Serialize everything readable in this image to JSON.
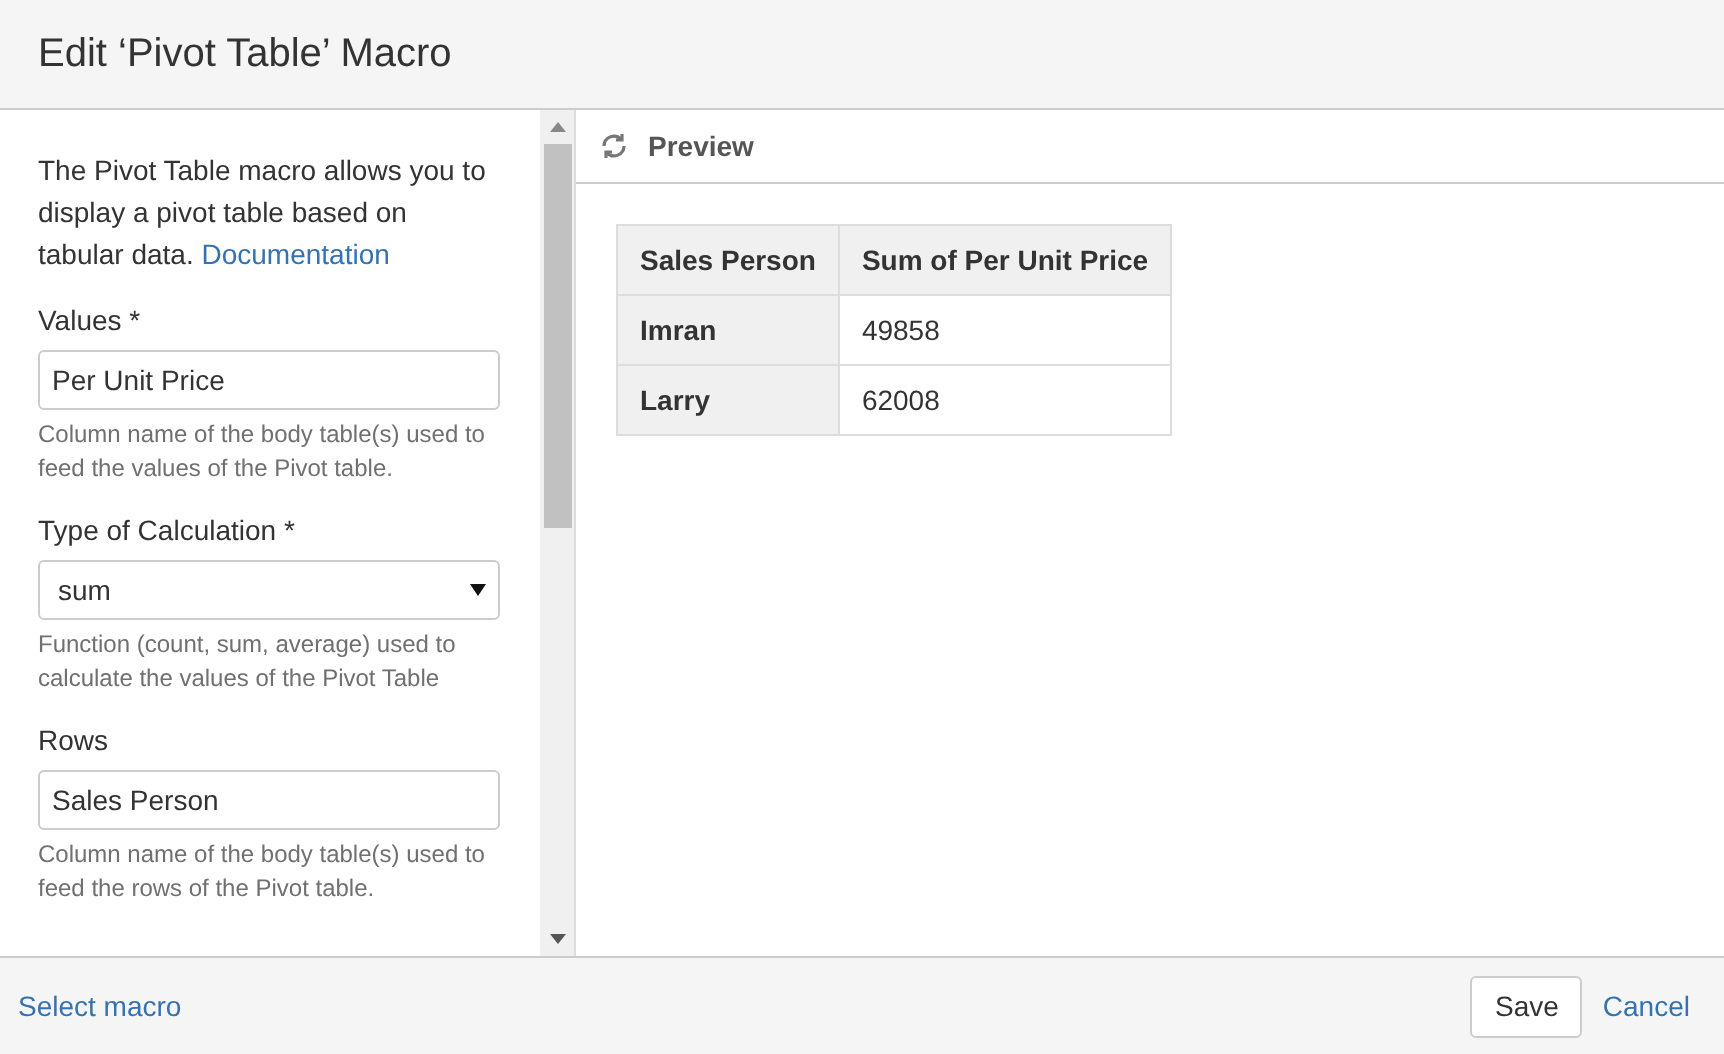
{
  "dialog": {
    "title": "Edit ‘Pivot Table’ Macro"
  },
  "form": {
    "description": "The Pivot Table macro allows you to display a pivot table based on tabular data.",
    "link": "Documentation",
    "fields": [
      {
        "kind": "text",
        "label": "Values *",
        "value": "Per Unit Price",
        "help": "Column name of the body table(s) used to feed the values of the Pivot table."
      },
      {
        "kind": "select",
        "label": "Type of Calculation *",
        "value": "sum",
        "help": "Function (count, sum, average) used to calculate the values of the Pivot Table"
      },
      {
        "kind": "text",
        "label": "Rows",
        "value": "Sales Person",
        "help": "Column name of the body table(s) used to feed the rows of the Pivot table."
      }
    ]
  },
  "preview": {
    "title": "Preview",
    "table": {
      "columns": [
        "Sales Person",
        "Sum of Per Unit Price"
      ],
      "rows": [
        [
          "Imran",
          "49858"
        ],
        [
          "Larry",
          "62008"
        ]
      ]
    }
  },
  "footer": {
    "left_link": "Select macro",
    "buttons": [
      {
        "kind": "button",
        "label": "Save"
      },
      {
        "kind": "link",
        "label": "Cancel"
      }
    ]
  }
}
